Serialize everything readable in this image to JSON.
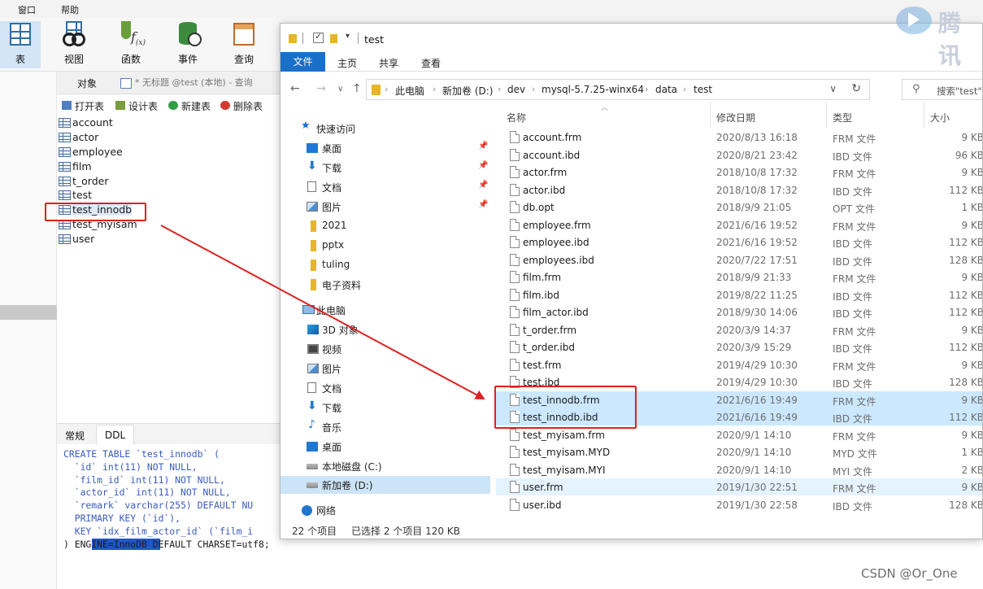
{
  "app": {
    "menu": [
      "窗口",
      "帮助"
    ],
    "toolbar": [
      {
        "label": "表",
        "icon": "table-grid-icon"
      },
      {
        "label": "视图",
        "icon": "glasses-icon"
      },
      {
        "label": "函数",
        "icon": "function-icon"
      },
      {
        "label": "事件",
        "icon": "event-icon"
      },
      {
        "label": "查询",
        "icon": "query-icon"
      }
    ],
    "object_tab": "对象",
    "untitled_tab": "* 无标题 @test (本地) - 查询",
    "object_toolbar": [
      "打开表",
      "设计表",
      "新建表",
      "删除表"
    ],
    "tables": [
      "account",
      "actor",
      "employee",
      "film",
      "t_order",
      "test",
      "test_innodb",
      "test_myisam",
      "user"
    ],
    "selected_table": "test_innodb",
    "ddl_tabs": [
      "常规",
      "DDL"
    ],
    "ddl_active_tab": "DDL",
    "ddl_lines": [
      "CREATE TABLE `test_innodb` (",
      "  `id` int(11) NOT NULL,",
      "  `film_id` int(11) NOT NULL,",
      "  `actor_id` int(11) NOT NULL,",
      "  `remark` varchar(255) DEFAULT NU",
      "  PRIMARY KEY (`id`),",
      "  KEY `idx_film_actor_id` (`film_i",
      ") ENGINE=InnoDB DEFAULT CHARSET=utf8;"
    ]
  },
  "explorer": {
    "title": "test",
    "ribbon_tabs": [
      "文件",
      "主页",
      "共享",
      "查看"
    ],
    "breadcrumb": [
      "此电脑",
      "新加卷 (D:)",
      "dev",
      "mysql-5.7.25-winx64",
      "data",
      "test"
    ],
    "search_placeholder": "搜索\"test\"",
    "nav": {
      "quick_access": "快速访问",
      "pinned": [
        "桌面",
        "下载",
        "文档",
        "图片"
      ],
      "folders": [
        "2021",
        "pptx",
        "tuling",
        "电子资料"
      ],
      "this_pc": "此电脑",
      "pc_items": [
        "3D 对象",
        "视频",
        "图片",
        "文档",
        "下载",
        "音乐",
        "桌面",
        "本地磁盘 (C:)",
        "新加卷 (D:)"
      ],
      "network": "网络",
      "selected": "新加卷 (D:)"
    },
    "columns": [
      "名称",
      "修改日期",
      "类型",
      "大小"
    ],
    "files": [
      {
        "name": "account.frm",
        "date": "2020/8/13 16:18",
        "type": "FRM 文件",
        "size": "9 KB"
      },
      {
        "name": "account.ibd",
        "date": "2020/8/21 23:42",
        "type": "IBD 文件",
        "size": "96 KB"
      },
      {
        "name": "actor.frm",
        "date": "2018/10/8 17:32",
        "type": "FRM 文件",
        "size": "9 KB"
      },
      {
        "name": "actor.ibd",
        "date": "2018/10/8 17:32",
        "type": "IBD 文件",
        "size": "112 KB"
      },
      {
        "name": "db.opt",
        "date": "2018/9/9 21:05",
        "type": "OPT 文件",
        "size": "1 KB"
      },
      {
        "name": "employee.frm",
        "date": "2021/6/16 19:52",
        "type": "FRM 文件",
        "size": "9 KB"
      },
      {
        "name": "employee.ibd",
        "date": "2021/6/16 19:52",
        "type": "IBD 文件",
        "size": "112 KB"
      },
      {
        "name": "employees.ibd",
        "date": "2020/7/22 17:51",
        "type": "IBD 文件",
        "size": "128 KB"
      },
      {
        "name": "film.frm",
        "date": "2018/9/9 21:33",
        "type": "FRM 文件",
        "size": "9 KB"
      },
      {
        "name": "film.ibd",
        "date": "2019/8/22 11:25",
        "type": "IBD 文件",
        "size": "112 KB"
      },
      {
        "name": "film_actor.ibd",
        "date": "2018/9/30 14:06",
        "type": "IBD 文件",
        "size": "112 KB"
      },
      {
        "name": "t_order.frm",
        "date": "2020/3/9 14:37",
        "type": "FRM 文件",
        "size": "9 KB"
      },
      {
        "name": "t_order.ibd",
        "date": "2020/3/9 15:29",
        "type": "IBD 文件",
        "size": "112 KB"
      },
      {
        "name": "test.frm",
        "date": "2019/4/29 10:30",
        "type": "FRM 文件",
        "size": "9 KB"
      },
      {
        "name": "test.ibd",
        "date": "2019/4/29 10:30",
        "type": "IBD 文件",
        "size": "128 KB"
      },
      {
        "name": "test_innodb.frm",
        "date": "2021/6/16 19:49",
        "type": "FRM 文件",
        "size": "9 KB",
        "selected": true
      },
      {
        "name": "test_innodb.ibd",
        "date": "2021/6/16 19:49",
        "type": "IBD 文件",
        "size": "112 KB",
        "selected": true
      },
      {
        "name": "test_myisam.frm",
        "date": "2020/9/1 14:10",
        "type": "FRM 文件",
        "size": "9 KB"
      },
      {
        "name": "test_myisam.MYD",
        "date": "2020/9/1 14:10",
        "type": "MYD 文件",
        "size": "1 KB"
      },
      {
        "name": "test_myisam.MYI",
        "date": "2020/9/1 14:10",
        "type": "MYI 文件",
        "size": "2 KB"
      },
      {
        "name": "user.frm",
        "date": "2019/1/30 22:51",
        "type": "FRM 文件",
        "size": "9 KB",
        "hover": true
      },
      {
        "name": "user.ibd",
        "date": "2019/1/30 22:58",
        "type": "IBD 文件",
        "size": "128 KB"
      }
    ],
    "status": {
      "count": "22 个项目",
      "selection": "已选择 2 个项目  120 KB"
    }
  },
  "annotation": {
    "color": "#e02020"
  },
  "watermark": {
    "text": "腾讯",
    "csdn": "CSDN @Or_One"
  }
}
